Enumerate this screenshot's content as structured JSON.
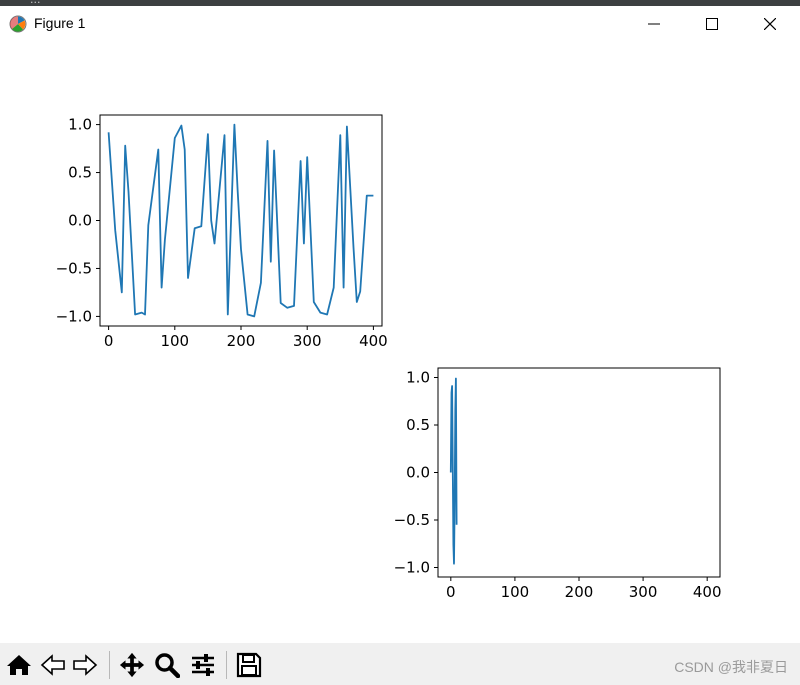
{
  "window": {
    "title": "Figure 1",
    "top_strip_texts": [
      "..."
    ]
  },
  "toolbar": {
    "buttons": [
      "home",
      "back",
      "forward",
      "pan",
      "zoom",
      "configure-subplots",
      "save"
    ],
    "watermark": "CSDN @我非夏日"
  },
  "colors": {
    "line": "#1f77b4",
    "toolbar_bg": "#f0f0f0",
    "top_strip": "#3c3f41"
  },
  "chart_data": [
    {
      "type": "line",
      "title": "",
      "xlabel": "",
      "ylabel": "",
      "xlim": [
        -13,
        413
      ],
      "ylim": [
        -1.1,
        1.1
      ],
      "xticks": [
        0,
        100,
        200,
        300,
        400
      ],
      "xtick_labels": [
        "0",
        "100",
        "200",
        "300",
        "400"
      ],
      "yticks": [
        1.0,
        0.5,
        0.0,
        -0.5,
        -1.0
      ],
      "ytick_labels": [
        "1.0",
        "0.5",
        "0.0",
        "−0.5",
        "−1.0"
      ],
      "grid": false,
      "series": [
        {
          "x": [
            0,
            10,
            20,
            25,
            30,
            40,
            50,
            55,
            60,
            75,
            80,
            85,
            100,
            110,
            115,
            120,
            130,
            140,
            150,
            155,
            160,
            175,
            180,
            190,
            195,
            200,
            210,
            220,
            230,
            240,
            245,
            250,
            260,
            270,
            280,
            290,
            295,
            300,
            310,
            320,
            330,
            340,
            350,
            355,
            360,
            370,
            375,
            380,
            390,
            400
          ],
          "y": [
            0.92,
            -0.1,
            -0.75,
            0.78,
            0.3,
            -0.98,
            -0.96,
            -0.98,
            -0.05,
            0.74,
            -0.7,
            -0.2,
            0.86,
            0.99,
            0.74,
            -0.6,
            -0.08,
            -0.06,
            0.9,
            0.0,
            -0.24,
            0.89,
            -0.98,
            1.0,
            0.3,
            -0.3,
            -0.98,
            -1.0,
            -0.65,
            0.83,
            -0.43,
            0.73,
            -0.86,
            -0.91,
            -0.89,
            0.62,
            -0.24,
            0.66,
            -0.85,
            -0.96,
            -0.98,
            -0.7,
            0.89,
            -0.7,
            0.98,
            -0.28,
            -0.85,
            -0.74,
            0.26,
            0.26
          ]
        }
      ]
    },
    {
      "type": "line",
      "title": "",
      "xlabel": "",
      "ylabel": "",
      "xlim": [
        -20,
        420
      ],
      "ylim": [
        -1.1,
        1.1
      ],
      "xticks": [
        0,
        100,
        200,
        300,
        400
      ],
      "xtick_labels": [
        "0",
        "100",
        "200",
        "300",
        "400"
      ],
      "yticks": [
        1.0,
        0.5,
        0.0,
        -0.5,
        -1.0
      ],
      "ytick_labels": [
        "1.0",
        "0.5",
        "0.0",
        "−0.5",
        "−1.0"
      ],
      "grid": false,
      "series": [
        {
          "x": [
            0,
            1,
            2,
            3,
            4,
            5,
            6,
            7,
            8,
            9
          ],
          "y": [
            0.0,
            0.84,
            0.91,
            0.14,
            -0.76,
            -0.96,
            -0.28,
            0.66,
            0.99,
            -0.55
          ]
        }
      ]
    }
  ]
}
